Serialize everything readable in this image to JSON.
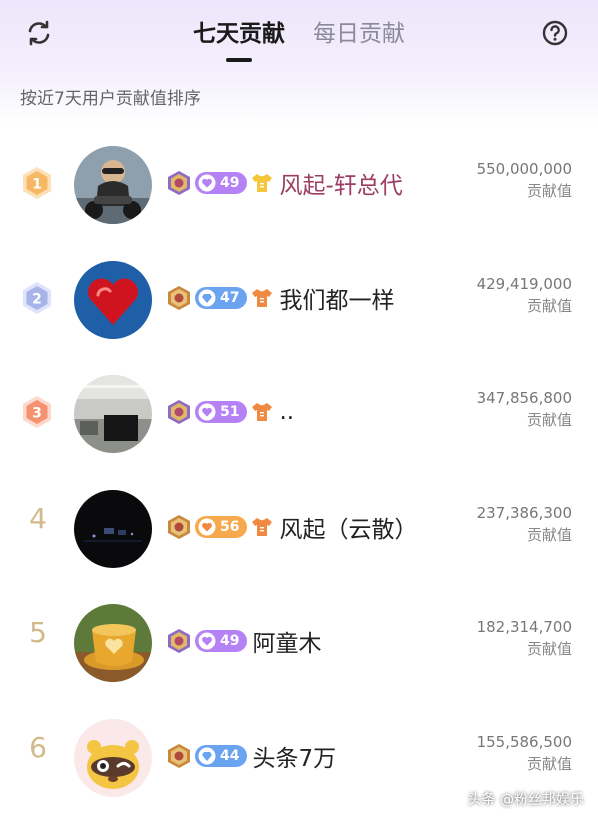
{
  "header": {
    "tabs": [
      {
        "label": "七天贡献",
        "active": true
      },
      {
        "label": "每日贡献",
        "active": false
      }
    ],
    "refresh_icon": "refresh-icon",
    "help_icon": "help-circle-icon"
  },
  "subtitle": "按近7天用户贡献值排序",
  "rows": [
    {
      "rank": "1",
      "rank_style": "gold",
      "name": "风起-轩总代",
      "level": "49",
      "level_color": "#b482f5",
      "shirt_color": "#f6c63a",
      "score": "550,000,000",
      "score_label": "贡献值"
    },
    {
      "rank": "2",
      "rank_style": "silver",
      "name": "我们都一样",
      "level": "47",
      "level_color": "#6aa3f0",
      "shirt_color": "#f08a43",
      "score": "429,419,000",
      "score_label": "贡献值"
    },
    {
      "rank": "3",
      "rank_style": "bronze",
      "name": "..",
      "level": "51",
      "level_color": "#b482f5",
      "shirt_color": "#f08a43",
      "score": "347,856,800",
      "score_label": "贡献值"
    },
    {
      "rank": "4",
      "rank_style": "plain",
      "name": "风起（云散）",
      "level": "56",
      "level_color": "#f7a94e",
      "shirt_color": "#f08a43",
      "score": "237,386,300",
      "score_label": "贡献值"
    },
    {
      "rank": "5",
      "rank_style": "plain",
      "name": "阿童木",
      "level": "49",
      "level_color": "#b482f5",
      "shirt_color": "",
      "score": "182,314,700",
      "score_label": "贡献值"
    },
    {
      "rank": "6",
      "rank_style": "plain",
      "name": "头条7万",
      "level": "44",
      "level_color": "#6aa3f0",
      "shirt_color": "",
      "score": "155,586,500",
      "score_label": "贡献值"
    }
  ],
  "watermark": "头条 @粉丝邦娱乐"
}
